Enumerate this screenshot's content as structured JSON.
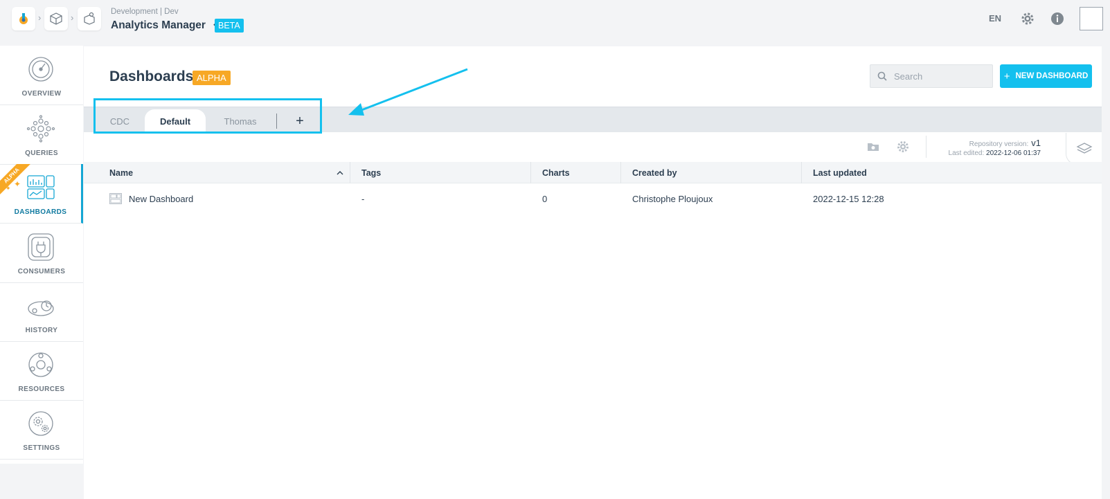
{
  "header": {
    "environment": "Development | Dev",
    "app_title": "Analytics Manager",
    "beta_badge": "BETA",
    "language": "EN"
  },
  "sidebar": {
    "alpha_ribbon": "ALPHA",
    "items": [
      {
        "label": "OVERVIEW",
        "icon": "gauge-icon"
      },
      {
        "label": "QUERIES",
        "icon": "dots-cluster-icon"
      },
      {
        "label": "DASHBOARDS",
        "icon": "dashboard-charts-icon",
        "active": true
      },
      {
        "label": "CONSUMERS",
        "icon": "plug-icon"
      },
      {
        "label": "HISTORY",
        "icon": "history-tracks-icon"
      },
      {
        "label": "RESOURCES",
        "icon": "resources-icon"
      },
      {
        "label": "SETTINGS",
        "icon": "settings-gears-icon"
      }
    ]
  },
  "main": {
    "title": "Dashboards",
    "alpha_badge": "ALPHA",
    "search_placeholder": "Search",
    "new_button": "NEW DASHBOARD",
    "tabs": [
      {
        "label": "CDC",
        "active": false
      },
      {
        "label": "Default",
        "active": true
      },
      {
        "label": "Thomas",
        "active": false
      }
    ],
    "add_tab": "+",
    "repository": {
      "version_label": "Repository version:",
      "version_value": "v1",
      "edited_label": "Last edited:",
      "edited_value": "2022-12-06 01:37"
    },
    "table": {
      "columns": [
        "Name",
        "Tags",
        "Charts",
        "Created by",
        "Last updated"
      ],
      "rows": [
        {
          "name": "New Dashboard",
          "tags": "-",
          "charts": "0",
          "created_by": "Christophe Ploujoux",
          "last_updated": "2022-12-15 12:28"
        }
      ]
    }
  },
  "colors": {
    "accent": "#14c0ee",
    "alpha": "#f7a825",
    "text": "#2c3e50"
  }
}
